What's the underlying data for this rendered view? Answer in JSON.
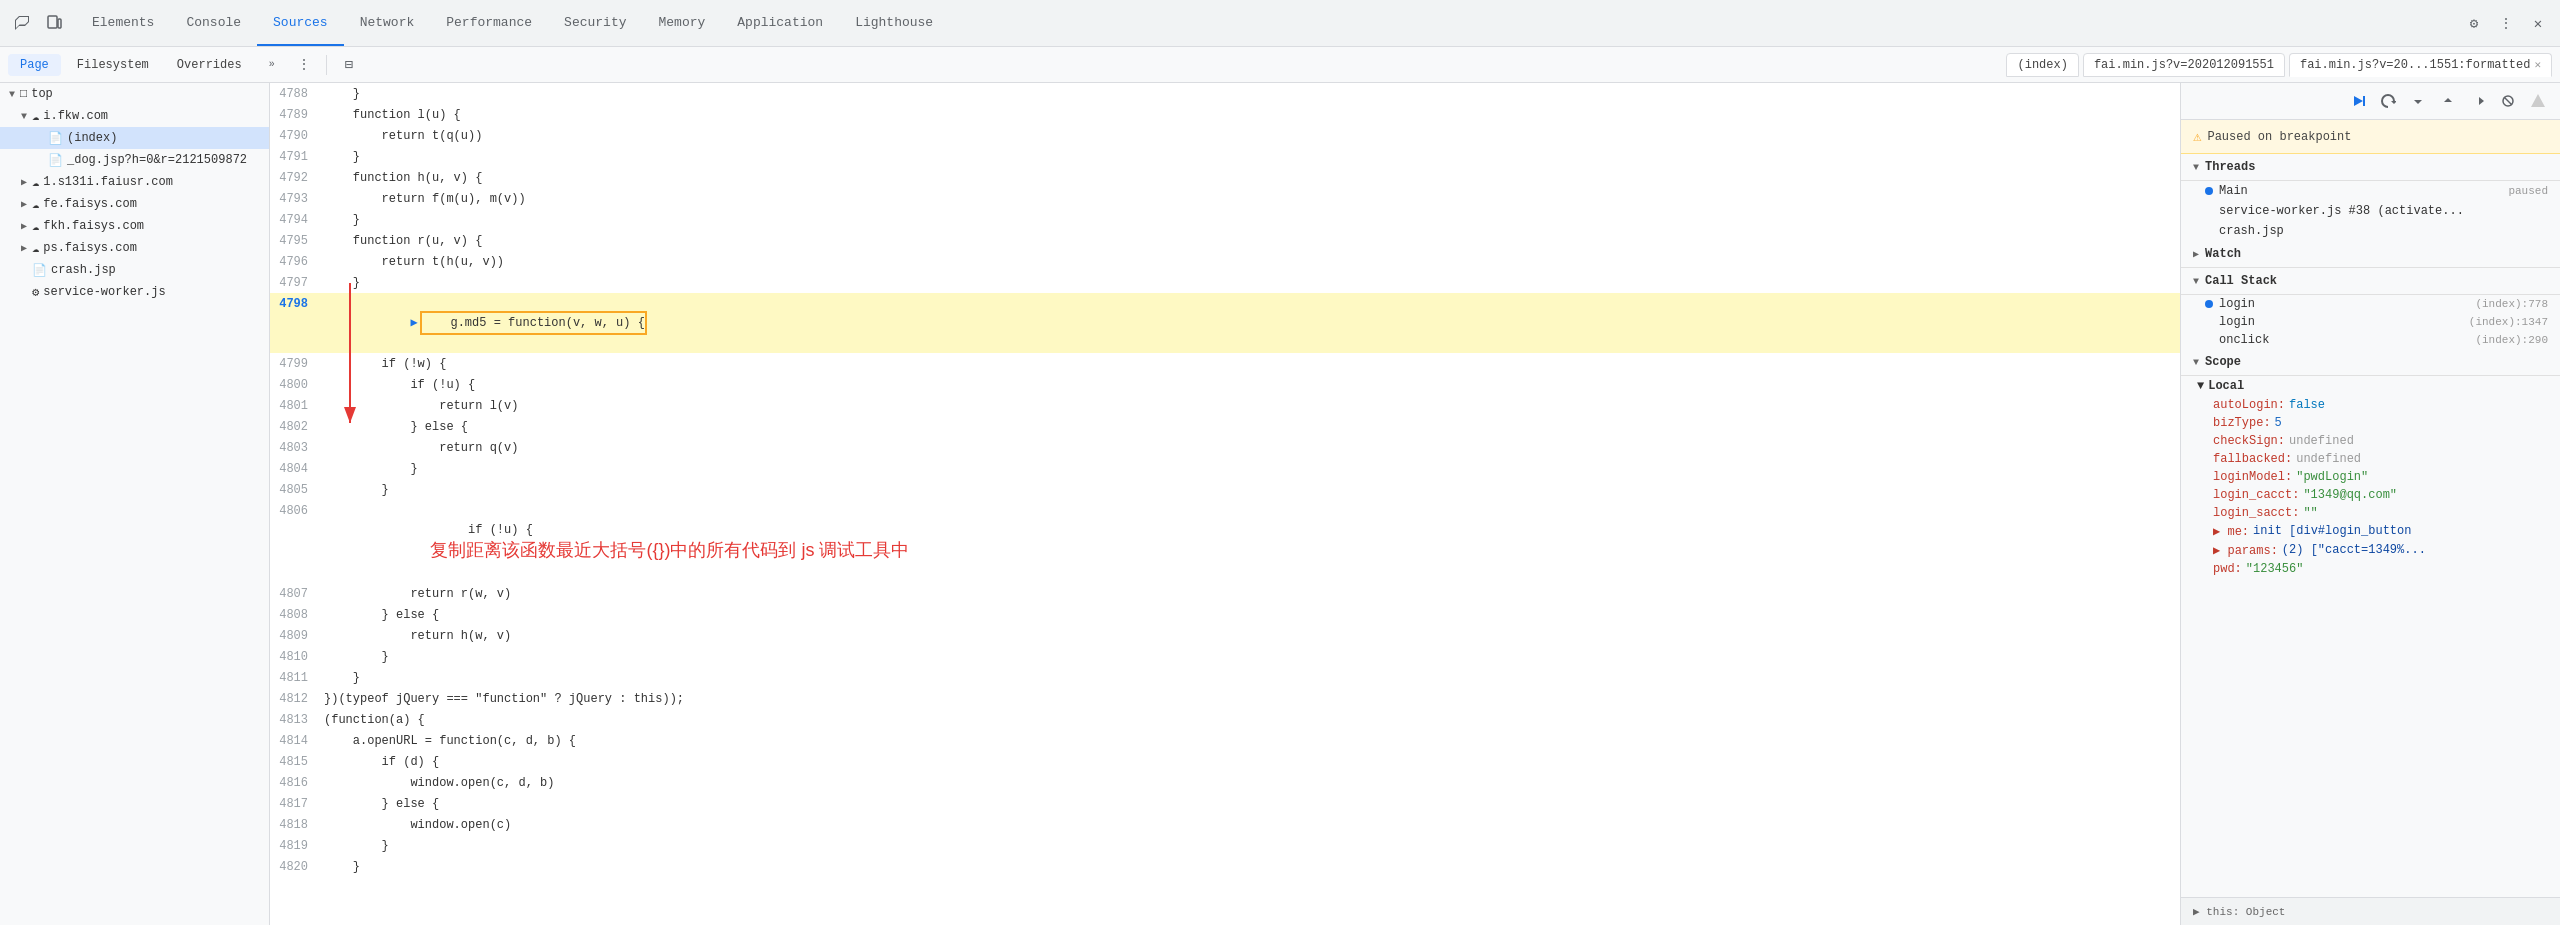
{
  "toolbar": {
    "tabs": [
      {
        "label": "Elements",
        "active": false
      },
      {
        "label": "Console",
        "active": false
      },
      {
        "label": "Sources",
        "active": true
      },
      {
        "label": "Network",
        "active": false
      },
      {
        "label": "Performance",
        "active": false
      },
      {
        "label": "Security",
        "active": false
      },
      {
        "label": "Memory",
        "active": false
      },
      {
        "label": "Application",
        "active": false
      },
      {
        "label": "Lighthouse",
        "active": false
      }
    ]
  },
  "subtabs": {
    "left": [
      {
        "label": "Page",
        "active": true
      },
      {
        "label": "Filesystem",
        "active": false
      },
      {
        "label": "Overrides",
        "active": false
      }
    ],
    "files": [
      {
        "label": "(index)",
        "active": false,
        "closeable": false
      },
      {
        "label": "fai.min.js?v=202012091551",
        "active": false,
        "closeable": false
      },
      {
        "label": "fai.min.js?v=20...1551:formatted",
        "active": true,
        "closeable": true
      }
    ]
  },
  "filetree": [
    {
      "indent": 0,
      "type": "folder",
      "label": "top",
      "expanded": true
    },
    {
      "indent": 1,
      "type": "cloud",
      "label": "i.fkw.com",
      "expanded": true
    },
    {
      "indent": 2,
      "type": "file",
      "label": "(index)",
      "selected": true
    },
    {
      "indent": 2,
      "type": "file",
      "label": "_dog.jsp?h=0&r=2121509872"
    },
    {
      "indent": 1,
      "type": "cloud",
      "label": "1.s131i.faiusr.com",
      "expanded": false
    },
    {
      "indent": 1,
      "type": "cloud",
      "label": "fe.faisys.com",
      "expanded": false
    },
    {
      "indent": 1,
      "type": "cloud",
      "label": "fkh.faisys.com",
      "expanded": false
    },
    {
      "indent": 1,
      "type": "cloud",
      "label": "ps.faisys.com",
      "expanded": false
    },
    {
      "indent": 1,
      "type": "file",
      "label": "crash.jsp"
    },
    {
      "indent": 1,
      "type": "worker",
      "label": "service-worker.js"
    }
  ],
  "code": {
    "lines": [
      {
        "num": 4788,
        "text": "    }"
      },
      {
        "num": 4789,
        "text": "    function l(u) {"
      },
      {
        "num": 4790,
        "text": "        return t(q(u))"
      },
      {
        "num": 4791,
        "text": "    }"
      },
      {
        "num": 4792,
        "text": "    function h(u, v) {"
      },
      {
        "num": 4793,
        "text": "        return f(m(u), m(v))"
      },
      {
        "num": 4794,
        "text": "    }"
      },
      {
        "num": 4795,
        "text": "    function r(u, v) {"
      },
      {
        "num": 4796,
        "text": "        return t(h(u, v))"
      },
      {
        "num": 4797,
        "text": "    }"
      },
      {
        "num": 4798,
        "text": "    g.md5 = function(v, w, u) {",
        "highlighted": true,
        "breakpoint": true
      },
      {
        "num": 4799,
        "text": "        if (!w) {"
      },
      {
        "num": 4800,
        "text": "            if (!u) {"
      },
      {
        "num": 4801,
        "text": "                return l(v)"
      },
      {
        "num": 4802,
        "text": "            } else {"
      },
      {
        "num": 4803,
        "text": "                return q(v)"
      },
      {
        "num": 4804,
        "text": "            }"
      },
      {
        "num": 4805,
        "text": "        }"
      },
      {
        "num": 4806,
        "text": "        if (!u) {",
        "annotation": true
      },
      {
        "num": 4807,
        "text": "            return r(w, v)"
      },
      {
        "num": 4808,
        "text": "        } else {"
      },
      {
        "num": 4809,
        "text": "            return h(w, v)"
      },
      {
        "num": 4810,
        "text": "        }"
      },
      {
        "num": 4811,
        "text": "    }"
      },
      {
        "num": 4812,
        "text": "})(typeof jQuery === \"function\" ? jQuery : this));"
      },
      {
        "num": 4813,
        "text": "(function(a) {"
      },
      {
        "num": 4814,
        "text": "    a.openURL = function(c, d, b) {"
      },
      {
        "num": 4815,
        "text": "        if (d) {"
      },
      {
        "num": 4816,
        "text": "            window.open(c, d, b)"
      },
      {
        "num": 4817,
        "text": "        } else {"
      },
      {
        "num": 4818,
        "text": "            window.open(c)"
      },
      {
        "num": 4819,
        "text": "        }"
      },
      {
        "num": 4820,
        "text": "    }"
      }
    ],
    "annotation_text": "复制距离该函数最近大括号({})中的所有代码到 js 调试工具中",
    "annotation_line": 4806
  },
  "right_panel": {
    "pause_text": "Paused on breakpoint",
    "sections": {
      "threads": {
        "label": "Threads",
        "items": [
          {
            "name": "Main",
            "status": "paused",
            "dot": true
          },
          {
            "name": "service-worker.js #38 (activate...",
            "status": "",
            "dot": false
          },
          {
            "name": "crash.jsp",
            "status": "",
            "dot": false
          }
        ]
      },
      "watch": {
        "label": "Watch"
      },
      "callstack": {
        "label": "Call Stack",
        "items": [
          {
            "name": "login",
            "loc": "(index):778",
            "dot": true
          },
          {
            "name": "login",
            "loc": "(index):1347",
            "dot": false
          },
          {
            "name": "onclick",
            "loc": "(index):290",
            "dot": false
          }
        ]
      },
      "scope": {
        "label": "Scope",
        "local": {
          "label": "Local",
          "props": [
            {
              "key": "autoLogin:",
              "val": "false",
              "type": "bool"
            },
            {
              "key": "bizType:",
              "val": "5",
              "type": "num"
            },
            {
              "key": "checkSign:",
              "val": "undefined",
              "type": "undef"
            },
            {
              "key": "fallbacked:",
              "val": "undefined",
              "type": "undef"
            },
            {
              "key": "loginModel:",
              "val": "\"pwdLogin\"",
              "type": "str"
            },
            {
              "key": "login_cacct:",
              "val": "\"1349@qq.com\"",
              "type": "str"
            },
            {
              "key": "login_sacct:",
              "val": "\"\"",
              "type": "str"
            },
            {
              "key": "▶ me:",
              "val": "init [div#login_button",
              "type": "expand"
            },
            {
              "key": "▶ params:",
              "val": "(2) [\"cacct=1349%...",
              "type": "expand"
            },
            {
              "key": "pwd:",
              "val": "\"123456\"",
              "type": "str"
            }
          ]
        }
      }
    }
  },
  "status_bar": {
    "this_label": "▶ this: Object"
  }
}
